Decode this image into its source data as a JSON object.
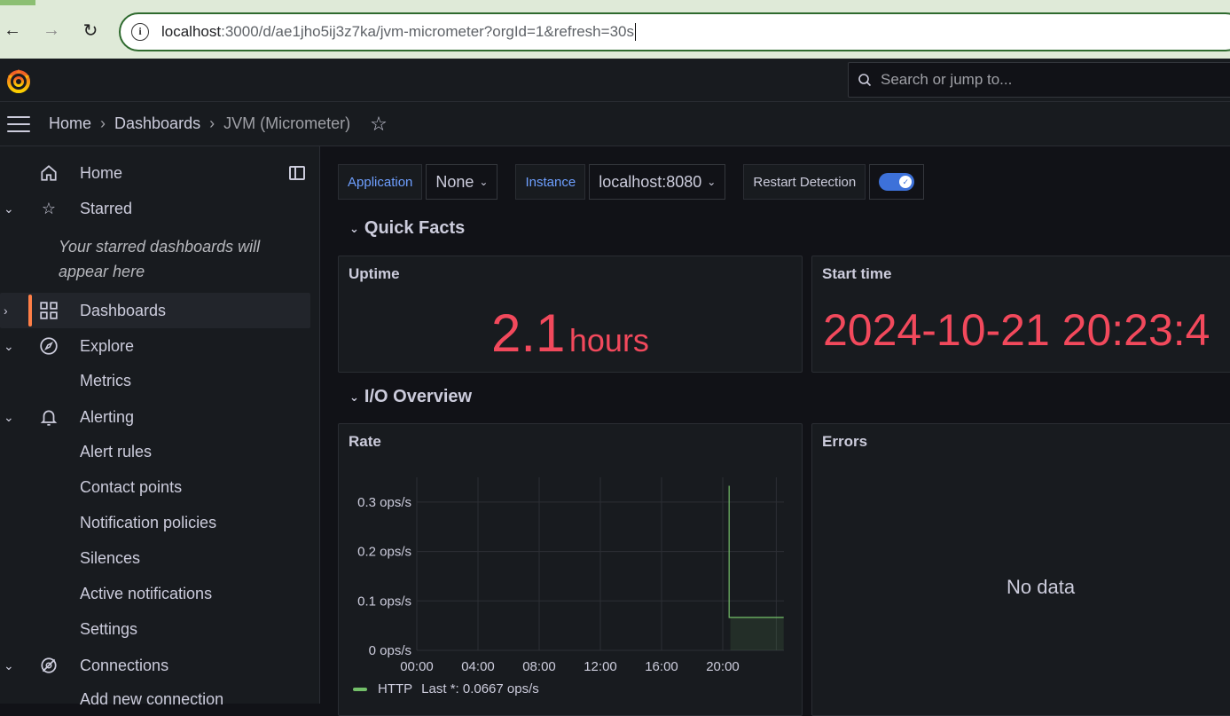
{
  "browser": {
    "url_host": "localhost",
    "url_path": ":3000/d/ae1jho5ij3z7ka/jvm-micrometer?orgId=1&refresh=30s",
    "back_icon": "arrow-left-icon",
    "forward_icon": "arrow-right-icon",
    "reload_icon": "reload-icon"
  },
  "topbar": {
    "search_placeholder": "Search or jump to..."
  },
  "breadcrumb": {
    "items": [
      "Home",
      "Dashboards"
    ],
    "current": "JVM (Micrometer)"
  },
  "sidebar": {
    "items": [
      {
        "label": "Home",
        "icon": "home-icon"
      },
      {
        "label": "Starred",
        "icon": "star-icon"
      },
      {
        "label": "Dashboards",
        "icon": "apps-icon"
      },
      {
        "label": "Explore",
        "icon": "compass-icon"
      },
      {
        "label": "Alerting",
        "icon": "bell-icon"
      },
      {
        "label": "Connections",
        "icon": "connections-icon"
      }
    ],
    "starred_empty": "Your starred dashboards will appear here",
    "explore_sub": [
      "Metrics"
    ],
    "alerting_sub": [
      "Alert rules",
      "Contact points",
      "Notification policies",
      "Silences",
      "Active notifications",
      "Settings"
    ],
    "connections_sub": [
      "Add new connection"
    ]
  },
  "variables": {
    "application_label": "Application",
    "application_value": "None",
    "instance_label": "Instance",
    "instance_value": "localhost:8080",
    "restart_label": "Restart Detection",
    "restart_enabled": true
  },
  "rows": {
    "quick_facts": "Quick Facts",
    "io_overview": "I/O Overview"
  },
  "panels": {
    "uptime": {
      "title": "Uptime",
      "value": "2.1",
      "unit": "hours"
    },
    "start_time": {
      "title": "Start time",
      "value": "2024-10-21 20:23:4"
    },
    "rate": {
      "title": "Rate"
    },
    "errors": {
      "title": "Errors",
      "empty": "No data"
    }
  },
  "colors": {
    "stat_red": "#f2495c",
    "series_green": "#73bf69",
    "accent_orange": "#ff7f47",
    "link_blue": "#6e9fff"
  },
  "chart_data": {
    "type": "line",
    "title": "Rate",
    "xlabel": "",
    "ylabel": "",
    "x_ticks": [
      "00:00",
      "04:00",
      "08:00",
      "12:00",
      "16:00",
      "20:00"
    ],
    "y_ticks": [
      "0 ops/s",
      "0.1 ops/s",
      "0.2 ops/s",
      "0.3 ops/s"
    ],
    "ylim": [
      0,
      0.35
    ],
    "grid": true,
    "legend_position": "bottom-left",
    "series": [
      {
        "name": "HTTP",
        "last_label": "Last *: 0.0667 ops/s",
        "points": [
          {
            "x": "20:20",
            "y": null
          },
          {
            "x": "20:25",
            "y": 0.333
          },
          {
            "x": "20:30",
            "y": 0.0667
          },
          {
            "x": "23:59",
            "y": 0.0667
          }
        ]
      }
    ]
  }
}
